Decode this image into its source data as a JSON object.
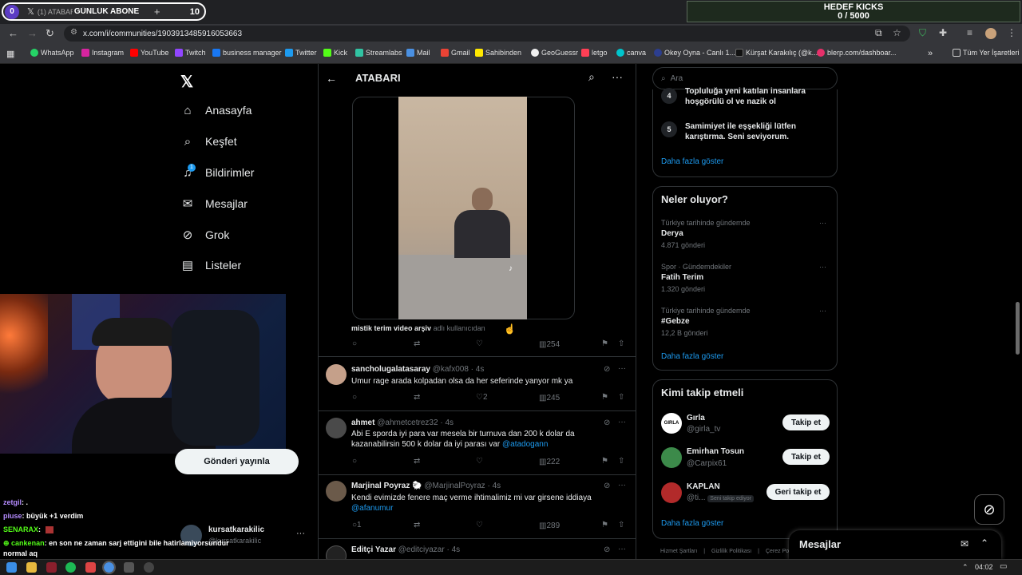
{
  "browser": {
    "tab_count": "0",
    "tab_title": "(1) ATABARI",
    "overlay_label": "GÜNLÜK ABONE",
    "overlay_count": "10",
    "url": "x.com/i/communities/1903913485916053663",
    "bookmarks": [
      "WhatsApp",
      "Instagram",
      "YouTube",
      "Twitch",
      "business manager",
      "Twitter",
      "Kick",
      "Streamlabs",
      "Mail",
      "Gmail",
      "Sahibinden",
      "GeoGuessr",
      "letgo",
      "canva",
      "Okey Oyna - Canlı 1...",
      "Kürşat Karakılıç (@k...",
      "blerp.com/dashboar..."
    ],
    "all_bookmarks": "Tüm Yer İşaretleri"
  },
  "kicks": {
    "label": "HEDEF KICKS",
    "value": "0 / 5000"
  },
  "sidebar": {
    "items": [
      {
        "label": "Anasayfa"
      },
      {
        "label": "Keşfet"
      },
      {
        "label": "Bildirimler",
        "badge": "1"
      },
      {
        "label": "Mesajlar"
      },
      {
        "label": "Grok"
      },
      {
        "label": "Listeler"
      }
    ],
    "post_button": "Gönderi yayınla",
    "account_name": "kursatkarakilic",
    "account_handle": "@kursatkarakilic"
  },
  "header": {
    "title": "ATABARI"
  },
  "video_post": {
    "caption": "mistik terim video arşiv",
    "caption_suffix": "adlı kullanıcıdan",
    "views": "254"
  },
  "posts": [
    {
      "name": "sancholugalatasaray",
      "handle": "@kafx008",
      "time": "4s",
      "text": "Umur rage arada kolpadan olsa da her seferinde yanyor mk ya",
      "mention": "",
      "replies": "",
      "likes": "2",
      "views": "245"
    },
    {
      "name": "ahmet",
      "handle": "@ahmetcetrez32",
      "time": "4s",
      "text": "Abi E sporda iyi para var mesela bir turnuva dan 200 k dolar da kazanabilirsin 500 k dolar da iyi parası var",
      "mention": "@atadogann",
      "replies": "",
      "likes": "",
      "views": "222"
    },
    {
      "name": "Marjinal Poyraz",
      "handle": "@MarjinalPoyraz",
      "time": "4s",
      "text": "Kendi evimizde fenere maç verme ihtimalimiz mi var girsene iddiaya",
      "mention": "@afanumur",
      "replies": "1",
      "likes": "",
      "views": "289"
    },
    {
      "name": "Editçi Yazar",
      "handle": "@editciyazar",
      "time": "4s",
      "text": "",
      "mention": "",
      "replies": "",
      "likes": "",
      "views": ""
    }
  ],
  "search": {
    "placeholder": "Ara"
  },
  "rules": {
    "items": [
      {
        "num": "4",
        "text": "Topluluğa yeni katılan insanlara hoşgörülü ol ve nazik ol"
      },
      {
        "num": "5",
        "text": "Samimiyet ile eşşekliği lütfen karıştırma. Seni seviyorum."
      }
    ],
    "more": "Daha fazla göster"
  },
  "trends": {
    "title": "Neler oluyor?",
    "items": [
      {
        "context": "Türkiye tarihinde gündemde",
        "name": "Derya",
        "count": "4.871 gönderi"
      },
      {
        "context": "Spor · Gündemdekiler",
        "name": "Fatih Terim",
        "count": "1.320 gönderi"
      },
      {
        "context": "Türkiye tarihinde gündemde",
        "name": "#Gebze",
        "count": "12,2 B gönderi"
      }
    ],
    "more": "Daha fazla göster"
  },
  "follow": {
    "title": "Kimi takip etmeli",
    "items": [
      {
        "name": "Gırla",
        "handle": "@girla_tv",
        "button": "Takip et",
        "note": ""
      },
      {
        "name": "Emirhan Tosun",
        "handle": "@Carpix61",
        "button": "Takip et",
        "note": ""
      },
      {
        "name": "KAPLAN",
        "handle": "@ti...",
        "button": "Geri takip et",
        "note": "Seni takip ediyor"
      }
    ],
    "more": "Daha fazla göster"
  },
  "footer": {
    "links": [
      "Hizmet Şartları",
      "Gizlilik Politikası",
      "Çerez Po..."
    ]
  },
  "messages": {
    "title": "Mesajlar"
  },
  "chat": [
    {
      "user": "zetgil",
      "color": "#b58cff",
      "text": ": ."
    },
    {
      "user": "piuse",
      "color": "#b58cff",
      "text": ": büyük +1 verdim"
    },
    {
      "user": "SENARAX",
      "color": "#53fc18",
      "text": ": "
    },
    {
      "user": "cankenan",
      "color": "#53fc18",
      "text": ": en son ne zaman sarj ettigini bile hatirlamiyorsundur normal aq"
    }
  ],
  "taskbar": {
    "time": "04:02"
  },
  "colors": {
    "accent": "#1d9bf0",
    "background": "#000000",
    "border": "#2f3336"
  }
}
